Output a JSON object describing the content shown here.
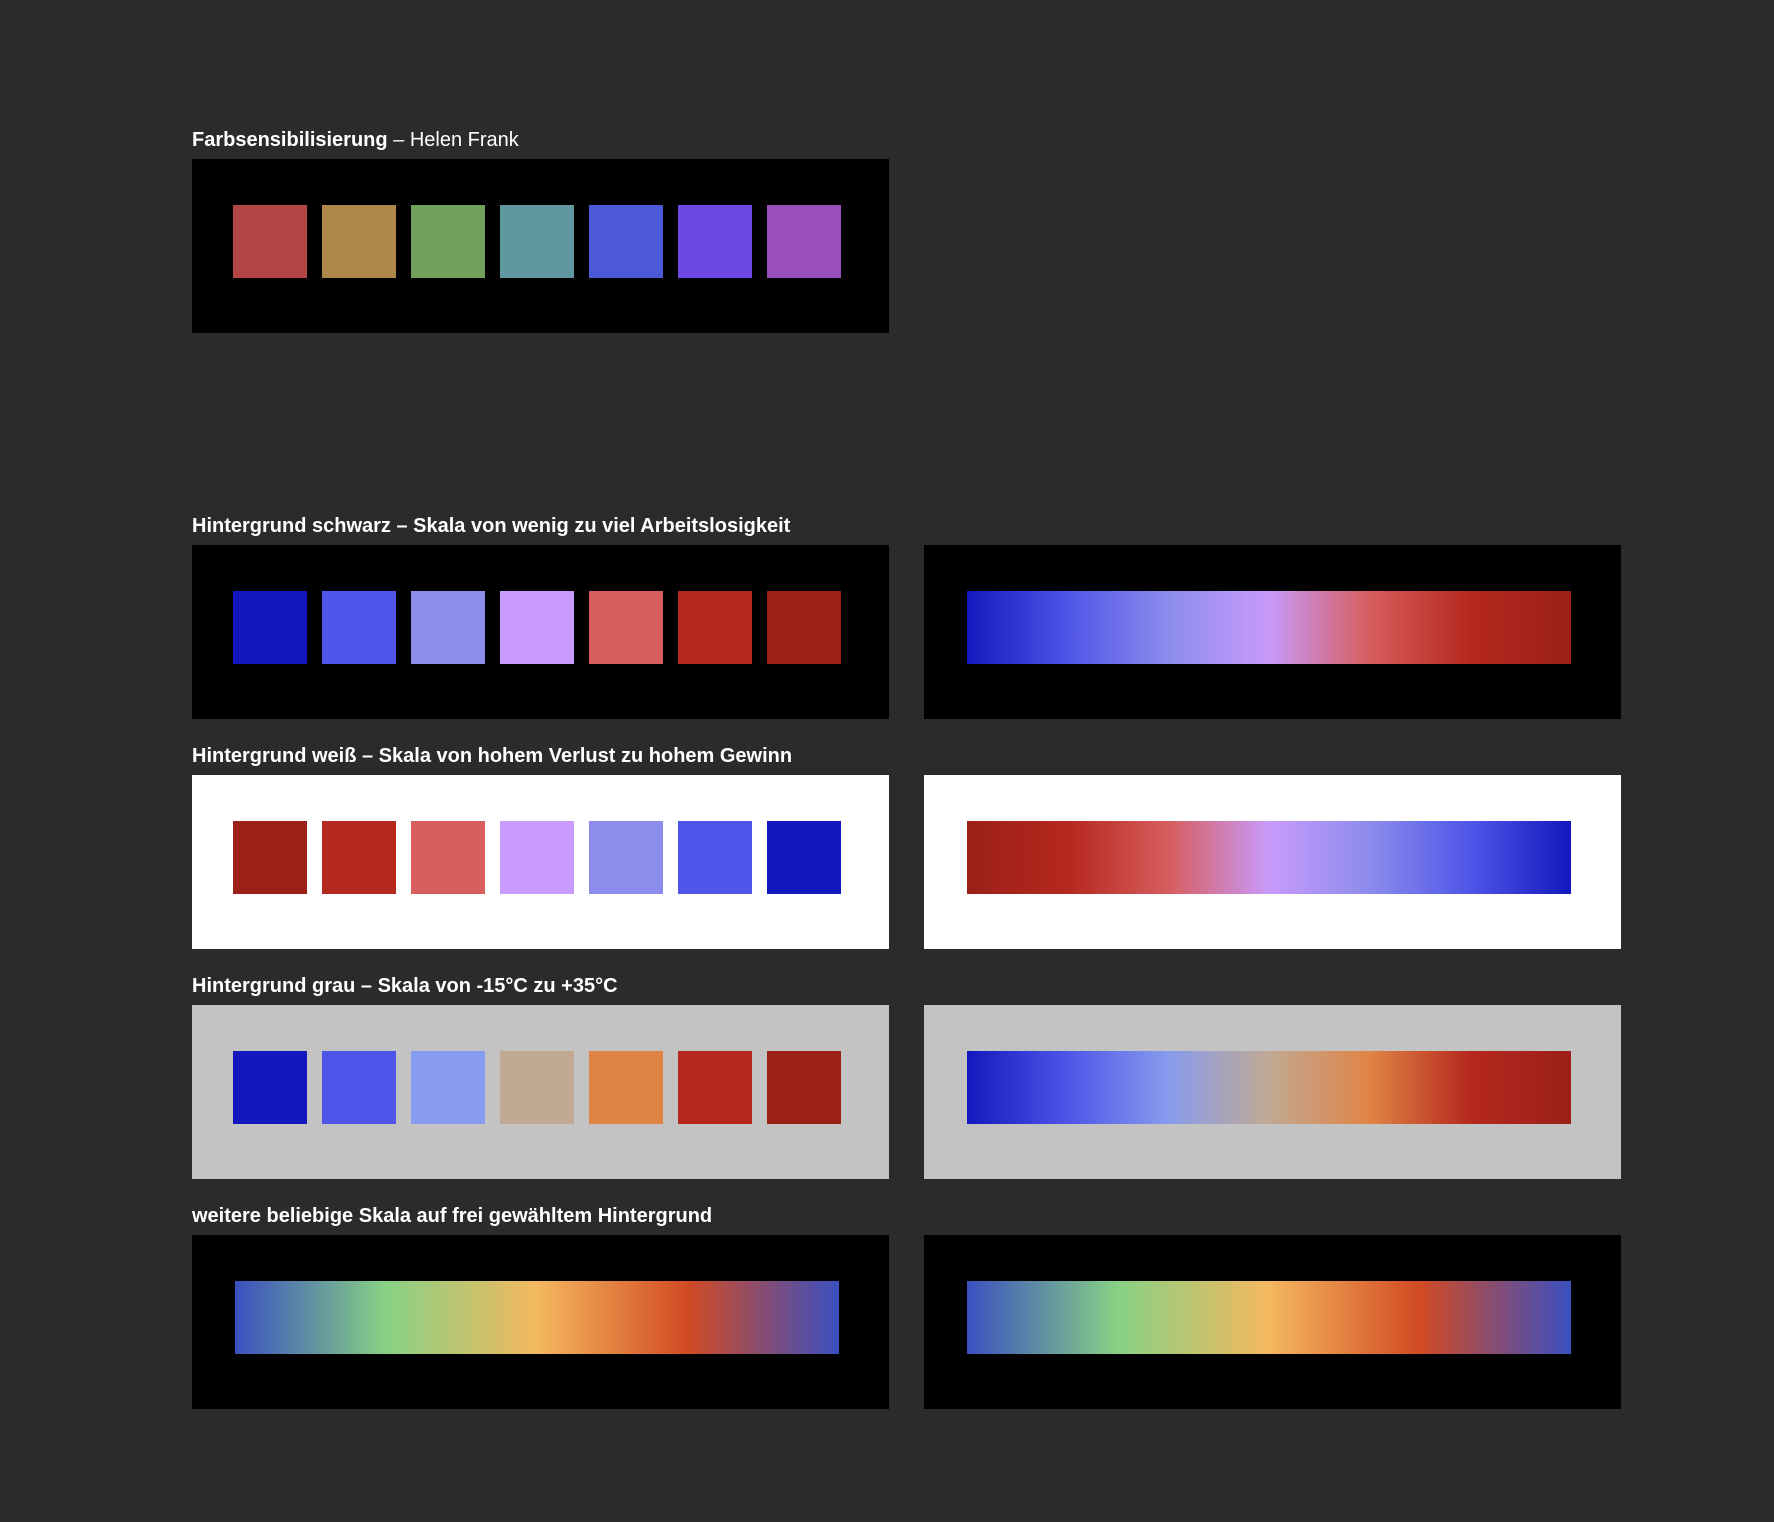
{
  "heading_sens": {
    "bold": "Farbsensibilisierung",
    "regular": " – Helen Frank"
  },
  "heading_black": "Hintergrund schwarz – Skala von wenig zu viel Arbeitslosigkeit",
  "heading_white": "Hintergrund weiß – Skala von hohem Verlust zu hohem Gewinn",
  "heading_grey": "Hintergrund grau – Skala von -15°C zu +35°C",
  "heading_free": "weitere beliebige Skala auf frei gewähltem Hintergrund",
  "backgrounds": {
    "page": "#2b2b2b",
    "sens": "#000000",
    "black": "#000000",
    "white": "#ffffff",
    "grey": "#c3c3c3",
    "free": "#000000"
  },
  "scales": {
    "sens": [
      "#b34545",
      "#ae8849",
      "#70a05a",
      "#5f999f",
      "#4c59d7",
      "#6d47e3",
      "#9a4fba"
    ],
    "black": [
      "#1318bd",
      "#4f55e8",
      "#8c8cec",
      "#c89afb",
      "#d75d5e",
      "#b5281e",
      "#9b2018"
    ],
    "white": [
      "#9b2018",
      "#b5281e",
      "#d75d5e",
      "#c89afb",
      "#8c8cec",
      "#4f55e8",
      "#1318bd"
    ],
    "grey": [
      "#1318bd",
      "#4f55e8",
      "#879cee",
      "#c1a993",
      "#e08445",
      "#b5281e",
      "#9b2018"
    ],
    "free": [
      "#3a50c0",
      "#88d184",
      "#f4b85e",
      "#d24a24",
      "#3a50c0"
    ]
  }
}
